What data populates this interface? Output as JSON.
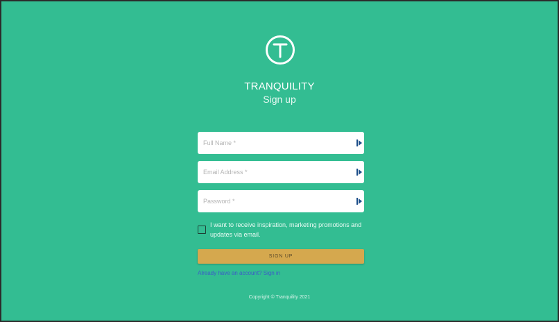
{
  "app": {
    "name": "TRANQUILITY",
    "subtitle": "Sign up"
  },
  "form": {
    "full_name": {
      "placeholder": "Full Name *",
      "value": ""
    },
    "email": {
      "placeholder": "Email Address *",
      "value": ""
    },
    "password": {
      "placeholder": "Password *",
      "value": ""
    },
    "marketing_opt_in": {
      "label": "I want to receive inspiration, marketing promotions and updates via email.",
      "checked": false
    },
    "submit_label": "SIGN UP",
    "signin_link": "Already have an account? Sign in"
  },
  "footer": {
    "copyright": "Copyright © Tranquility 2021"
  },
  "colors": {
    "background": "#33bd92",
    "button": "#d5a84e",
    "link": "#3d59c9"
  },
  "icons": {
    "logo": "t-circle-logo-icon",
    "field_autofill": "autofill-icon"
  }
}
